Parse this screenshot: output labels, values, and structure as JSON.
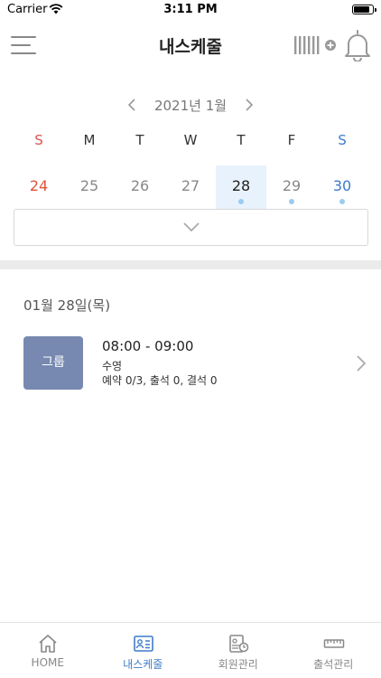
{
  "status_bar": {
    "carrier": "Carrier",
    "time": "3:11 PM",
    "battery_level": 0.9
  },
  "header": {
    "title": "내스케줄",
    "menu_icon": "hamburger-menu-icon",
    "barcode_icon": "barcode-add-icon",
    "bell_icon": "bell-icon"
  },
  "calendar": {
    "month_label": "2021년 1월",
    "weekdays": [
      "S",
      "M",
      "T",
      "W",
      "T",
      "F",
      "S"
    ],
    "days": [
      {
        "label": "24",
        "type": "sun",
        "selected": false,
        "has_event": false
      },
      {
        "label": "25",
        "type": "weekday",
        "selected": false,
        "has_event": false
      },
      {
        "label": "26",
        "type": "weekday",
        "selected": false,
        "has_event": false
      },
      {
        "label": "27",
        "type": "weekday",
        "selected": false,
        "has_event": false
      },
      {
        "label": "28",
        "type": "weekday",
        "selected": true,
        "has_event": true
      },
      {
        "label": "29",
        "type": "weekday",
        "selected": false,
        "has_event": true
      },
      {
        "label": "30",
        "type": "sat",
        "selected": false,
        "has_event": true
      }
    ]
  },
  "schedule": {
    "date_heading": "01월 28일(목)",
    "items": [
      {
        "badge": "그룹",
        "time": "08:00 - 09:00",
        "name": "수영",
        "stats": "예약 0/3, 출석 0, 결석 0"
      }
    ]
  },
  "tabs": [
    {
      "label": "HOME",
      "icon": "home-icon",
      "active": false
    },
    {
      "label": "내스케줄",
      "icon": "schedule-card-icon",
      "active": true
    },
    {
      "label": "회원관리",
      "icon": "member-manage-icon",
      "active": false
    },
    {
      "label": "출석관리",
      "icon": "attendance-ruler-icon",
      "active": false
    }
  ],
  "colors": {
    "accent": "#3d7cc9",
    "sunday": "#e0533a",
    "badge": "#7789b0",
    "selected_day_bg": "#e8f2fc",
    "event_dot": "#9ccbf0"
  }
}
